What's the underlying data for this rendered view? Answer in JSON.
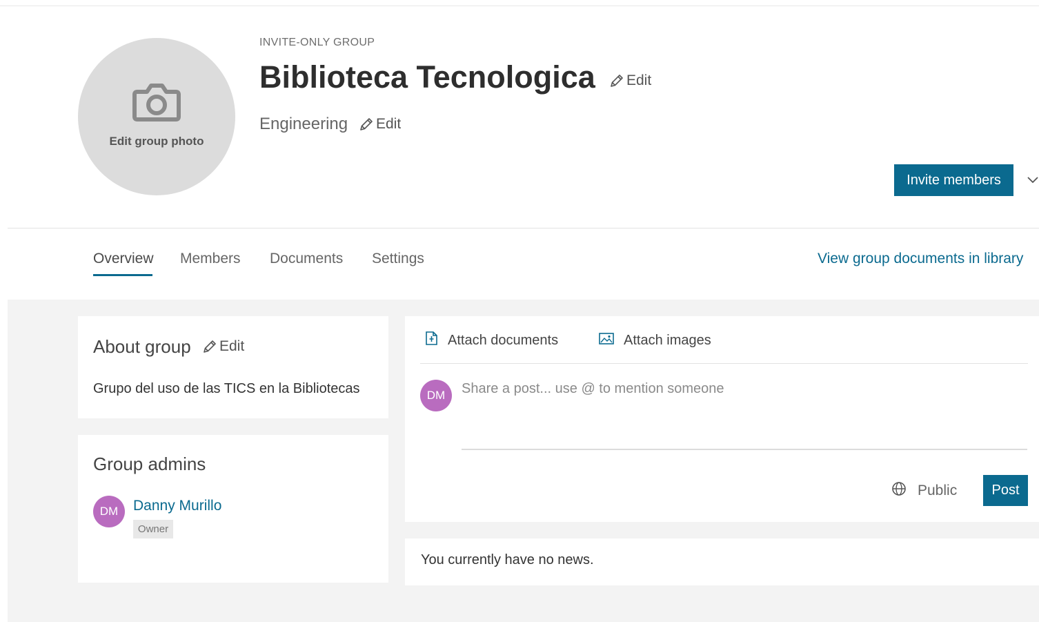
{
  "header": {
    "group_type": "INVITE-ONLY GROUP",
    "group_name": "Biblioteca Tecnologica",
    "edit_label": "Edit",
    "discipline": "Engineering",
    "photo_label": "Edit group photo",
    "invite_button": "Invite members"
  },
  "tabs": [
    {
      "label": "Overview",
      "active": true
    },
    {
      "label": "Members",
      "active": false
    },
    {
      "label": "Documents",
      "active": false
    },
    {
      "label": "Settings",
      "active": false
    }
  ],
  "library_link": "View group documents in library",
  "about": {
    "title": "About group",
    "edit_label": "Edit",
    "description": "Grupo del uso de las TICS en la Bibliotecas"
  },
  "admins": {
    "title": "Group admins",
    "items": [
      {
        "initials": "DM",
        "name": "Danny Murillo",
        "role": "Owner"
      }
    ]
  },
  "composer": {
    "attach_documents": "Attach documents",
    "attach_images": "Attach images",
    "avatar_initials": "DM",
    "placeholder": "Share a post... use @ to mention someone",
    "visibility": "Public",
    "post_button": "Post"
  },
  "news": {
    "empty_text": "You currently have no news."
  },
  "colors": {
    "accent": "#0b6a8f",
    "avatar": "#b96cbf",
    "photo_placeholder": "#dcdcdc",
    "content_background": "#f3f3f3"
  },
  "icons": [
    "camera-icon",
    "pencil-icon",
    "chevron-down-icon",
    "attach-document-icon",
    "attach-image-icon",
    "globe-icon"
  ]
}
